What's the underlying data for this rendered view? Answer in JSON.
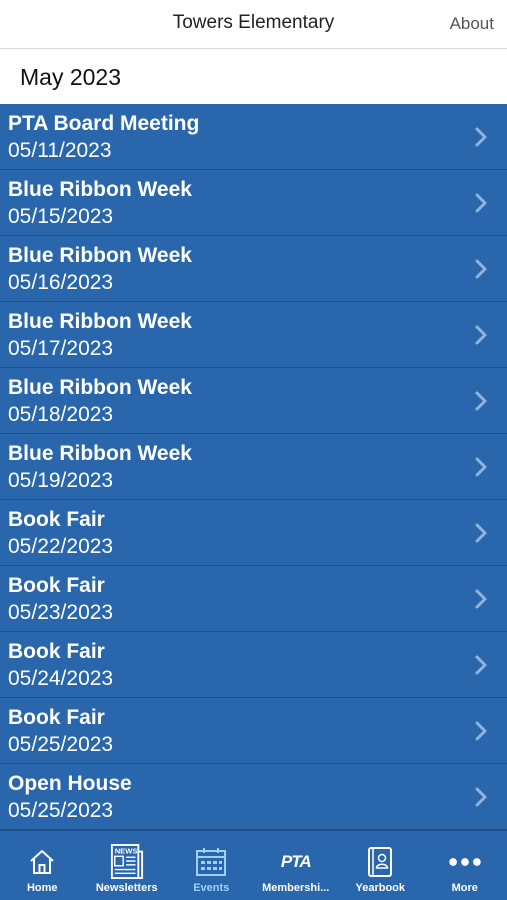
{
  "header": {
    "title": "Towers Elementary",
    "about_label": "About"
  },
  "month_label": "May 2023",
  "events": [
    {
      "name": "PTA Board Meeting",
      "date": "05/11/2023"
    },
    {
      "name": "Blue Ribbon Week",
      "date": "05/15/2023"
    },
    {
      "name": "Blue Ribbon Week",
      "date": "05/16/2023"
    },
    {
      "name": "Blue Ribbon Week",
      "date": "05/17/2023"
    },
    {
      "name": "Blue Ribbon Week",
      "date": "05/18/2023"
    },
    {
      "name": "Blue Ribbon Week",
      "date": "05/19/2023"
    },
    {
      "name": "Book Fair",
      "date": "05/22/2023"
    },
    {
      "name": "Book Fair",
      "date": "05/23/2023"
    },
    {
      "name": "Book Fair",
      "date": "05/24/2023"
    },
    {
      "name": "Book Fair",
      "date": "05/25/2023"
    },
    {
      "name": "Open House",
      "date": "05/25/2023"
    }
  ],
  "tabbar": {
    "tabs": [
      {
        "label": "Home",
        "icon": "home-icon"
      },
      {
        "label": "Newsletters",
        "icon": "newspaper-icon"
      },
      {
        "label": "Events",
        "icon": "calendar-icon",
        "active": true
      },
      {
        "label": "Membershi...",
        "icon": "pta-logo-icon"
      },
      {
        "label": "Yearbook",
        "icon": "yearbook-icon"
      },
      {
        "label": "More",
        "icon": "more-dots-icon"
      }
    ],
    "pta_logo_text": "PTA",
    "newspaper_logo_text": "NEWS"
  },
  "colors": {
    "row_bg": "#2a66ac",
    "active_tab": "#9fd0ff"
  }
}
